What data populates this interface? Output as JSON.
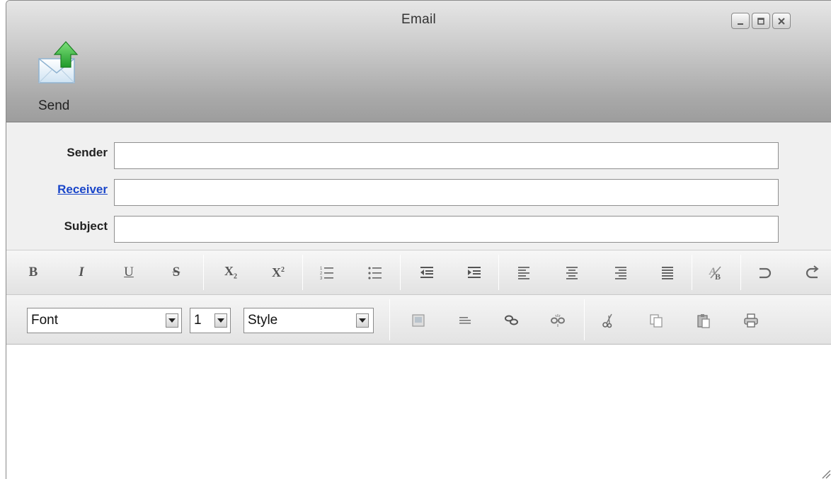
{
  "window": {
    "title": "Email"
  },
  "controls": [
    "minimize-icon",
    "maximize-icon",
    "close-icon"
  ],
  "toolbar": {
    "send_label": "Send",
    "send_icon": "send-email-icon"
  },
  "form": {
    "sender": {
      "label": "Sender",
      "value": ""
    },
    "receiver": {
      "label": "Receiver",
      "value": ""
    },
    "subject": {
      "label": "Subject",
      "value": ""
    }
  },
  "format_toolbar": {
    "groups": [
      [
        "bold",
        "italic",
        "underline",
        "strikethrough"
      ],
      [
        "subscript",
        "superscript"
      ],
      [
        "ordered-list",
        "unordered-list"
      ],
      [
        "outdent",
        "indent"
      ],
      [
        "align-left",
        "align-center",
        "align-right",
        "justify"
      ],
      [
        "remove-format"
      ],
      [
        "undo",
        "redo"
      ]
    ]
  },
  "selects": {
    "font": "Font",
    "size": "1",
    "style": "Style"
  },
  "colors": {
    "link": "#1a46c9",
    "accent_green": "#3db33d"
  }
}
